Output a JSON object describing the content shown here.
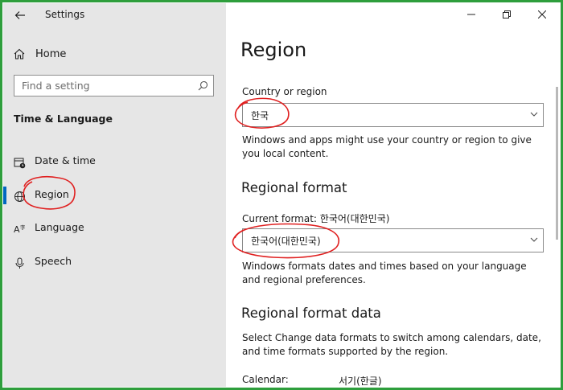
{
  "window": {
    "title": "Settings"
  },
  "sidebar": {
    "home_label": "Home",
    "search_placeholder": "Find a setting",
    "section_title": "Time & Language",
    "items": [
      {
        "label": "Date & time",
        "icon": "calendar-clock-icon",
        "selected": false
      },
      {
        "label": "Region",
        "icon": "globe-icon",
        "selected": true
      },
      {
        "label": "Language",
        "icon": "language-icon",
        "selected": false
      },
      {
        "label": "Speech",
        "icon": "microphone-icon",
        "selected": false
      }
    ]
  },
  "main": {
    "title": "Region",
    "country": {
      "label": "Country or region",
      "value": "한국",
      "description": "Windows and apps might use your country or region to give you local content."
    },
    "regional_format": {
      "heading": "Regional format",
      "current_label": "Current format: 한국어(대한민국)",
      "value": "한국어(대한민국)",
      "description": "Windows formats dates and times based on your language and regional preferences."
    },
    "format_data": {
      "heading": "Regional format data",
      "description": "Select Change data formats to switch among calendars, date, and time formats supported by the region.",
      "calendar_label": "Calendar:",
      "calendar_value": "서기(한글)"
    }
  },
  "colors": {
    "sidebar_bg": "#e6e6e6",
    "accent": "#0067c0",
    "annotation": "#e02020",
    "frame": "#2e9e3c"
  }
}
